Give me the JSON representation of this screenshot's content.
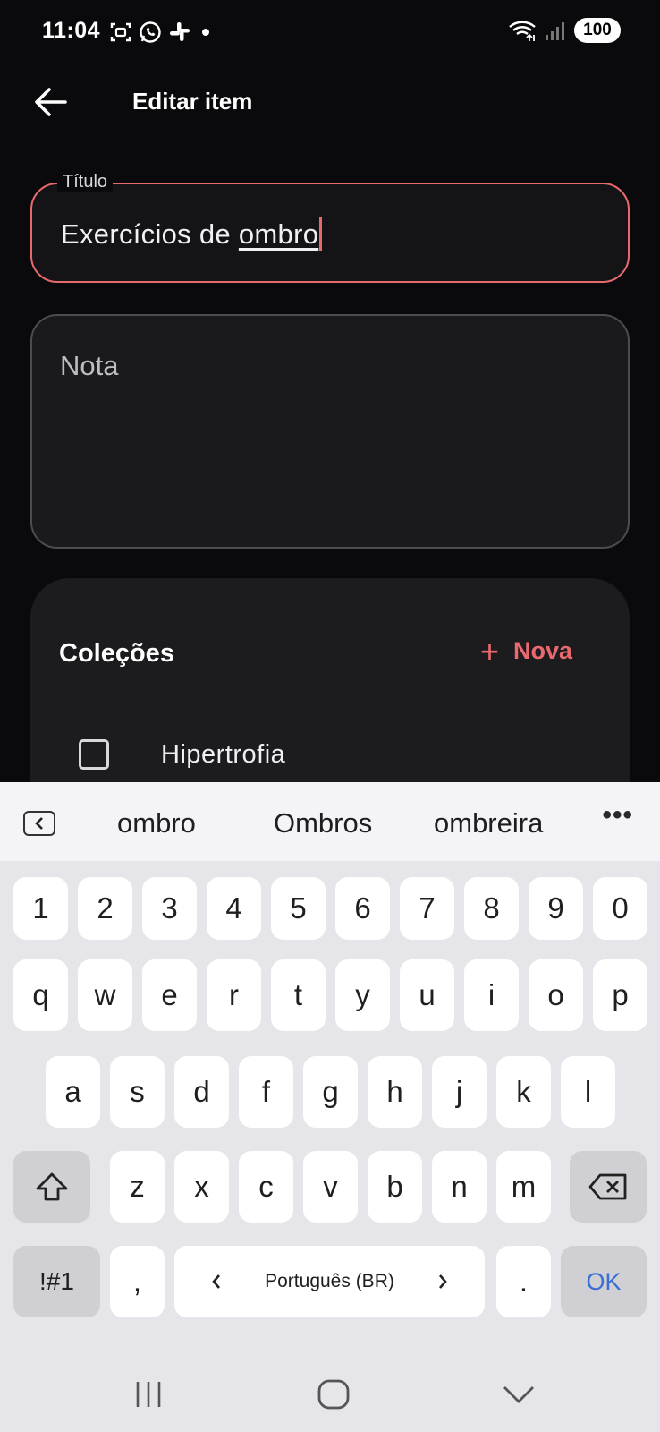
{
  "status_bar": {
    "time": "11:04",
    "battery": "100",
    "left_icons": [
      "screenshot-icon",
      "whatsapp-icon",
      "slack-icon",
      "dot-icon"
    ],
    "right_icons": [
      "wifi-icon",
      "signal-icon"
    ]
  },
  "app_bar": {
    "title": "Editar item"
  },
  "form": {
    "title_label": "Título",
    "title_value_prefix": "Exercícios de ",
    "title_value_word": "ombro",
    "note_placeholder": "Nota"
  },
  "collections": {
    "heading": "Coleções",
    "new_label": "Nova",
    "items": [
      {
        "label": "Hipertrofia",
        "checked": false
      }
    ]
  },
  "keyboard": {
    "suggestions": [
      "ombro",
      "Ombros",
      "ombreira"
    ],
    "more": "•••",
    "row_numbers": [
      "1",
      "2",
      "3",
      "4",
      "5",
      "6",
      "7",
      "8",
      "9",
      "0"
    ],
    "row_1": [
      "q",
      "w",
      "e",
      "r",
      "t",
      "y",
      "u",
      "i",
      "o",
      "p"
    ],
    "row_2": [
      "a",
      "s",
      "d",
      "f",
      "g",
      "h",
      "j",
      "k",
      "l"
    ],
    "row_3": [
      "z",
      "x",
      "c",
      "v",
      "b",
      "n",
      "m"
    ],
    "symbols_label": "!#1",
    "comma": ",",
    "space_label": "Português (BR)",
    "period": ".",
    "ok_label": "OK"
  },
  "colors": {
    "accent": "#e8696e",
    "background": "#0a0a0c",
    "card": "#1c1c1f",
    "keyboard_bg": "#e6e6ea",
    "ok_blue": "#3a6fd6"
  }
}
